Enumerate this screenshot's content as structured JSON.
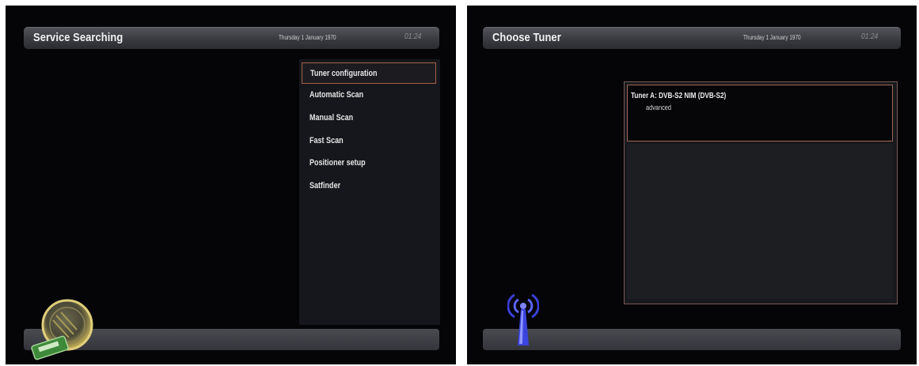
{
  "left_screen": {
    "title": "Service Searching",
    "date": "Thursday 1 January 1970",
    "time": "01:24",
    "menu": [
      {
        "label": "Tuner configuration",
        "selected": true
      },
      {
        "label": "Automatic Scan",
        "selected": false
      },
      {
        "label": "Manual Scan",
        "selected": false
      },
      {
        "label": "Fast Scan",
        "selected": false
      },
      {
        "label": "Positioner setup",
        "selected": false
      },
      {
        "label": "Satfinder",
        "selected": false
      }
    ],
    "icon": "satellite-dish-icon"
  },
  "right_screen": {
    "title": "Choose Tuner",
    "date": "Thursday 1 January 1970",
    "time": "01:24",
    "tuners": [
      {
        "name": "Tuner A: DVB-S2 NIM (DVB-S2)",
        "mode": "advanced"
      }
    ],
    "icon": "antenna-signal-icon"
  },
  "colors": {
    "background": "#050507",
    "bar": "#3a3b40",
    "selection_border": "#a3624a",
    "text": "#e6e6e6"
  }
}
